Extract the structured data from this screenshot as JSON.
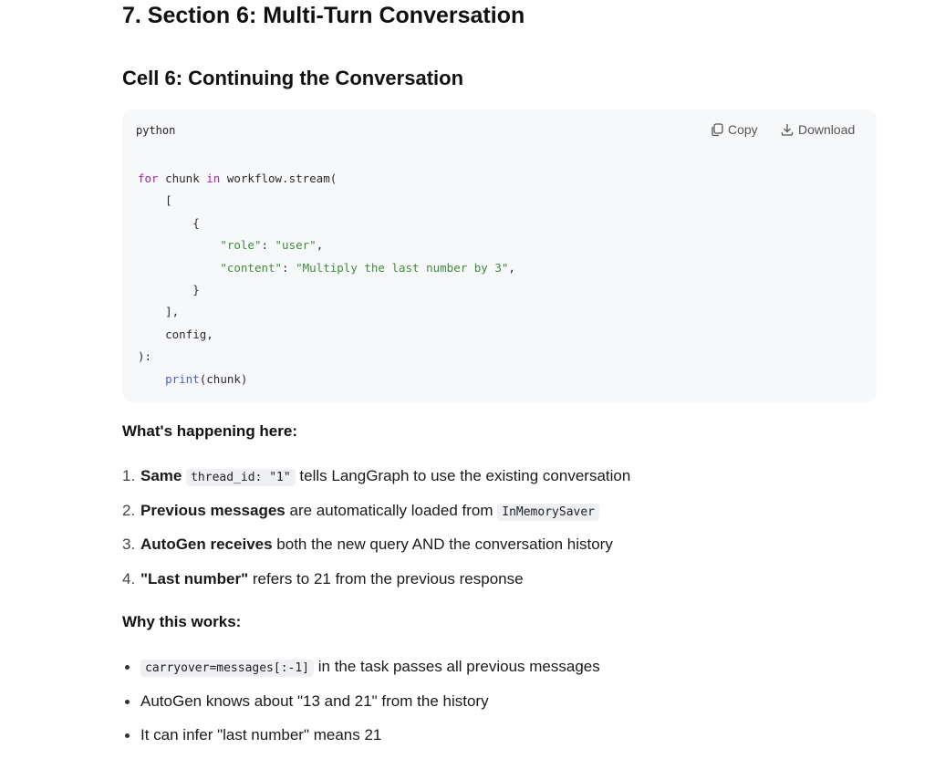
{
  "section": {
    "title": "7. Section 6: Multi-Turn Conversation"
  },
  "cell": {
    "title": "Cell 6: Continuing the Conversation"
  },
  "code_block": {
    "language": "python",
    "copy_label": "Copy",
    "download_label": "Download",
    "lines": {
      "l1": {
        "kw": "for",
        "a": " chunk ",
        "kw2": "in",
        "b": " workflow.stream("
      },
      "l2": "    [",
      "l3": "        {",
      "l4": {
        "indent": "            ",
        "key": "\"role\"",
        "colon": ": ",
        "val": "\"user\"",
        "end": ","
      },
      "l5": {
        "indent": "            ",
        "key": "\"content\"",
        "colon": ": ",
        "val": "\"Multiply the last number by 3\"",
        "end": ","
      },
      "l6": "        }",
      "l7": "    ],",
      "l8": "    config,",
      "l9": "):",
      "l10": {
        "indent": "    ",
        "fn": "print",
        "rest": "(chunk)"
      }
    }
  },
  "happening": {
    "heading": "What's happening here:",
    "items": [
      {
        "num": "1.",
        "bold": "Same",
        "code": "thread_id: \"1\"",
        "rest": "tells LangGraph to use the existing conversation"
      },
      {
        "num": "2.",
        "bold": "Previous messages",
        "rest": "are automatically loaded from",
        "code": "InMemorySaver"
      },
      {
        "num": "3.",
        "bold": "AutoGen receives",
        "rest": "both the new query AND the conversation history"
      },
      {
        "num": "4.",
        "bold": "\"Last number\"",
        "rest": "refers to 21 from the previous response"
      }
    ]
  },
  "why": {
    "heading": "Why this works:",
    "items": [
      {
        "code": "carryover=messages[:-1]",
        "rest": "in the task passes all previous messages"
      },
      {
        "text": "AutoGen knows about \"13 and 21\" from the history"
      },
      {
        "text": "It can infer \"last number\" means 21"
      }
    ]
  },
  "colors": {
    "keyword": "#a626a4",
    "function": "#4a5bd0",
    "string": "#3d8d3a",
    "code_bg": "#f7f8fa",
    "inline_code_bg": "#eef0f3"
  }
}
